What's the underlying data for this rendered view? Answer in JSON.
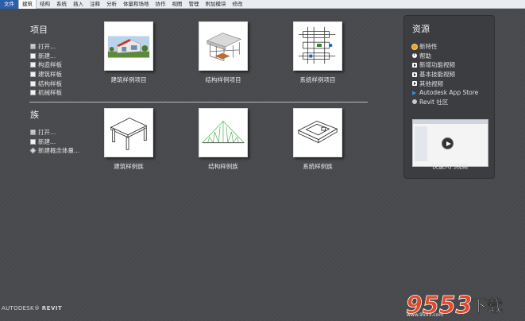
{
  "menubar": {
    "items": [
      "文件",
      "建筑",
      "结构",
      "系统",
      "插入",
      "注释",
      "分析",
      "体量和场地",
      "协作",
      "视图",
      "管理",
      "附加模块",
      "修改"
    ],
    "file_color": "#2b5fa8"
  },
  "projects": {
    "title": "项目",
    "links": [
      "打开...",
      "新建...",
      "构造样板",
      "建筑样板",
      "结构样板",
      "机械样板"
    ],
    "tiles": [
      {
        "label": "建筑样例项目",
        "icon": "architectural-house-icon"
      },
      {
        "label": "结构样例项目",
        "icon": "structural-frame-icon"
      },
      {
        "label": "系统样例项目",
        "icon": "mep-systems-icon"
      }
    ]
  },
  "families": {
    "title": "族",
    "links": [
      "打开...",
      "新建...",
      "新建概念体量..."
    ],
    "tiles": [
      {
        "label": "建筑样例族",
        "icon": "table-icon"
      },
      {
        "label": "结构样例族",
        "icon": "truss-icon"
      },
      {
        "label": "系统样例族",
        "icon": "fixture-icon"
      }
    ]
  },
  "resources": {
    "title": "资源",
    "links": [
      "新特性",
      "帮助",
      "新增功能视频",
      "基本技能视频",
      "其他视频",
      "Autodesk App Store",
      "Revit 社区"
    ],
    "video_label": "快速入门视频"
  },
  "brand": {
    "company": "AUTODESK",
    "product": "REVIT"
  },
  "watermark": {
    "text": "9553",
    "suffix": "下载",
    "sub": "www.9553.com"
  }
}
